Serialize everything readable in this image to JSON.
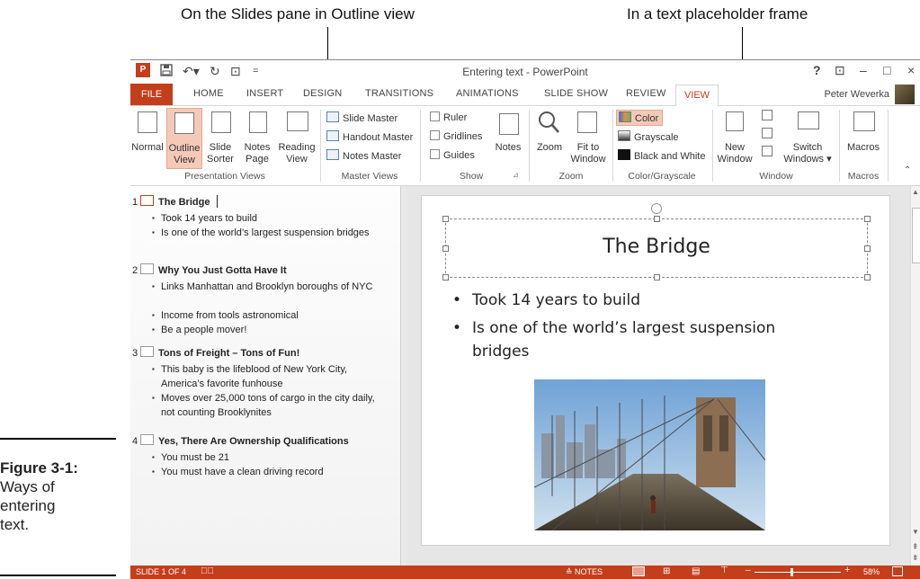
{
  "callouts": {
    "left": "On the Slides pane in Outline view",
    "right": "In a text placeholder frame"
  },
  "figure": {
    "label": "Figure 3-1:",
    "caption_lines": [
      "Ways of",
      "entering",
      "text."
    ]
  },
  "app": {
    "window_title": "Entering text - PowerPoint",
    "user_name": "Peter Weverka",
    "controls": {
      "help": "?",
      "ribbon_display": "⊡",
      "minimize": "–",
      "maximize": "□",
      "close": "×"
    },
    "tabs": [
      "FILE",
      "HOME",
      "INSERT",
      "DESIGN",
      "TRANSITIONS",
      "ANIMATIONS",
      "SLIDE SHOW",
      "REVIEW",
      "VIEW"
    ],
    "active_tab": "VIEW"
  },
  "ribbon": {
    "presentation_views": {
      "group": "Presentation Views",
      "buttons": [
        {
          "l1": "Normal",
          "l2": ""
        },
        {
          "l1": "Outline",
          "l2": "View"
        },
        {
          "l1": "Slide",
          "l2": "Sorter"
        },
        {
          "l1": "Notes",
          "l2": "Page"
        },
        {
          "l1": "Reading",
          "l2": "View"
        }
      ]
    },
    "master_views": {
      "group": "Master Views",
      "items": [
        "Slide Master",
        "Handout Master",
        "Notes Master"
      ]
    },
    "show": {
      "group": "Show",
      "items": [
        "Ruler",
        "Gridlines",
        "Guides"
      ],
      "notes": "Notes"
    },
    "zoom": {
      "group": "Zoom",
      "zoom_label": "Zoom",
      "fit_l1": "Fit to",
      "fit_l2": "Window"
    },
    "color": {
      "group": "Color/Grayscale",
      "items": [
        "Color",
        "Grayscale",
        "Black and White"
      ],
      "accent": "#f5c9b8"
    },
    "window": {
      "group": "Window",
      "new_l1": "New",
      "new_l2": "Window",
      "switch_l1": "Switch",
      "switch_l2": "Windows ▾"
    },
    "macros": {
      "group": "Macros",
      "label": "Macros"
    }
  },
  "outline": {
    "slides": [
      {
        "num": "1",
        "title": "The Bridge",
        "bullets": [
          "Took 14 years to build",
          "Is one of the world’s largest suspension bridges"
        ]
      },
      {
        "num": "2",
        "title": "Why You Just Gotta Have It",
        "bullets": [
          "Links Manhattan  and Brooklyn  boroughs of NYC",
          "Income from tools astronomical",
          "Be a people mover!"
        ]
      },
      {
        "num": "3",
        "title": "Tons of Freight – Tons of Fun!",
        "bullets": [
          "This baby is the lifeblood of New York City, America’s favorite funhouse",
          "Moves over 25,000 tons of cargo in the city daily, not counting  Brooklynites"
        ]
      },
      {
        "num": "4",
        "title": "Yes, There Are Ownership Qualifications",
        "bullets": [
          "You must be 21",
          "You must have a clean driving record"
        ]
      }
    ]
  },
  "slide": {
    "title": "The Bridge",
    "bullets": [
      "Took 14 years to build",
      "Is one of the world’s largest suspension bridges"
    ]
  },
  "status": {
    "slide_info": "SLIDE 1 OF 4",
    "notes": "≙ NOTES",
    "zoom": "58%"
  },
  "colors": {
    "accent": "#c43e1c"
  }
}
